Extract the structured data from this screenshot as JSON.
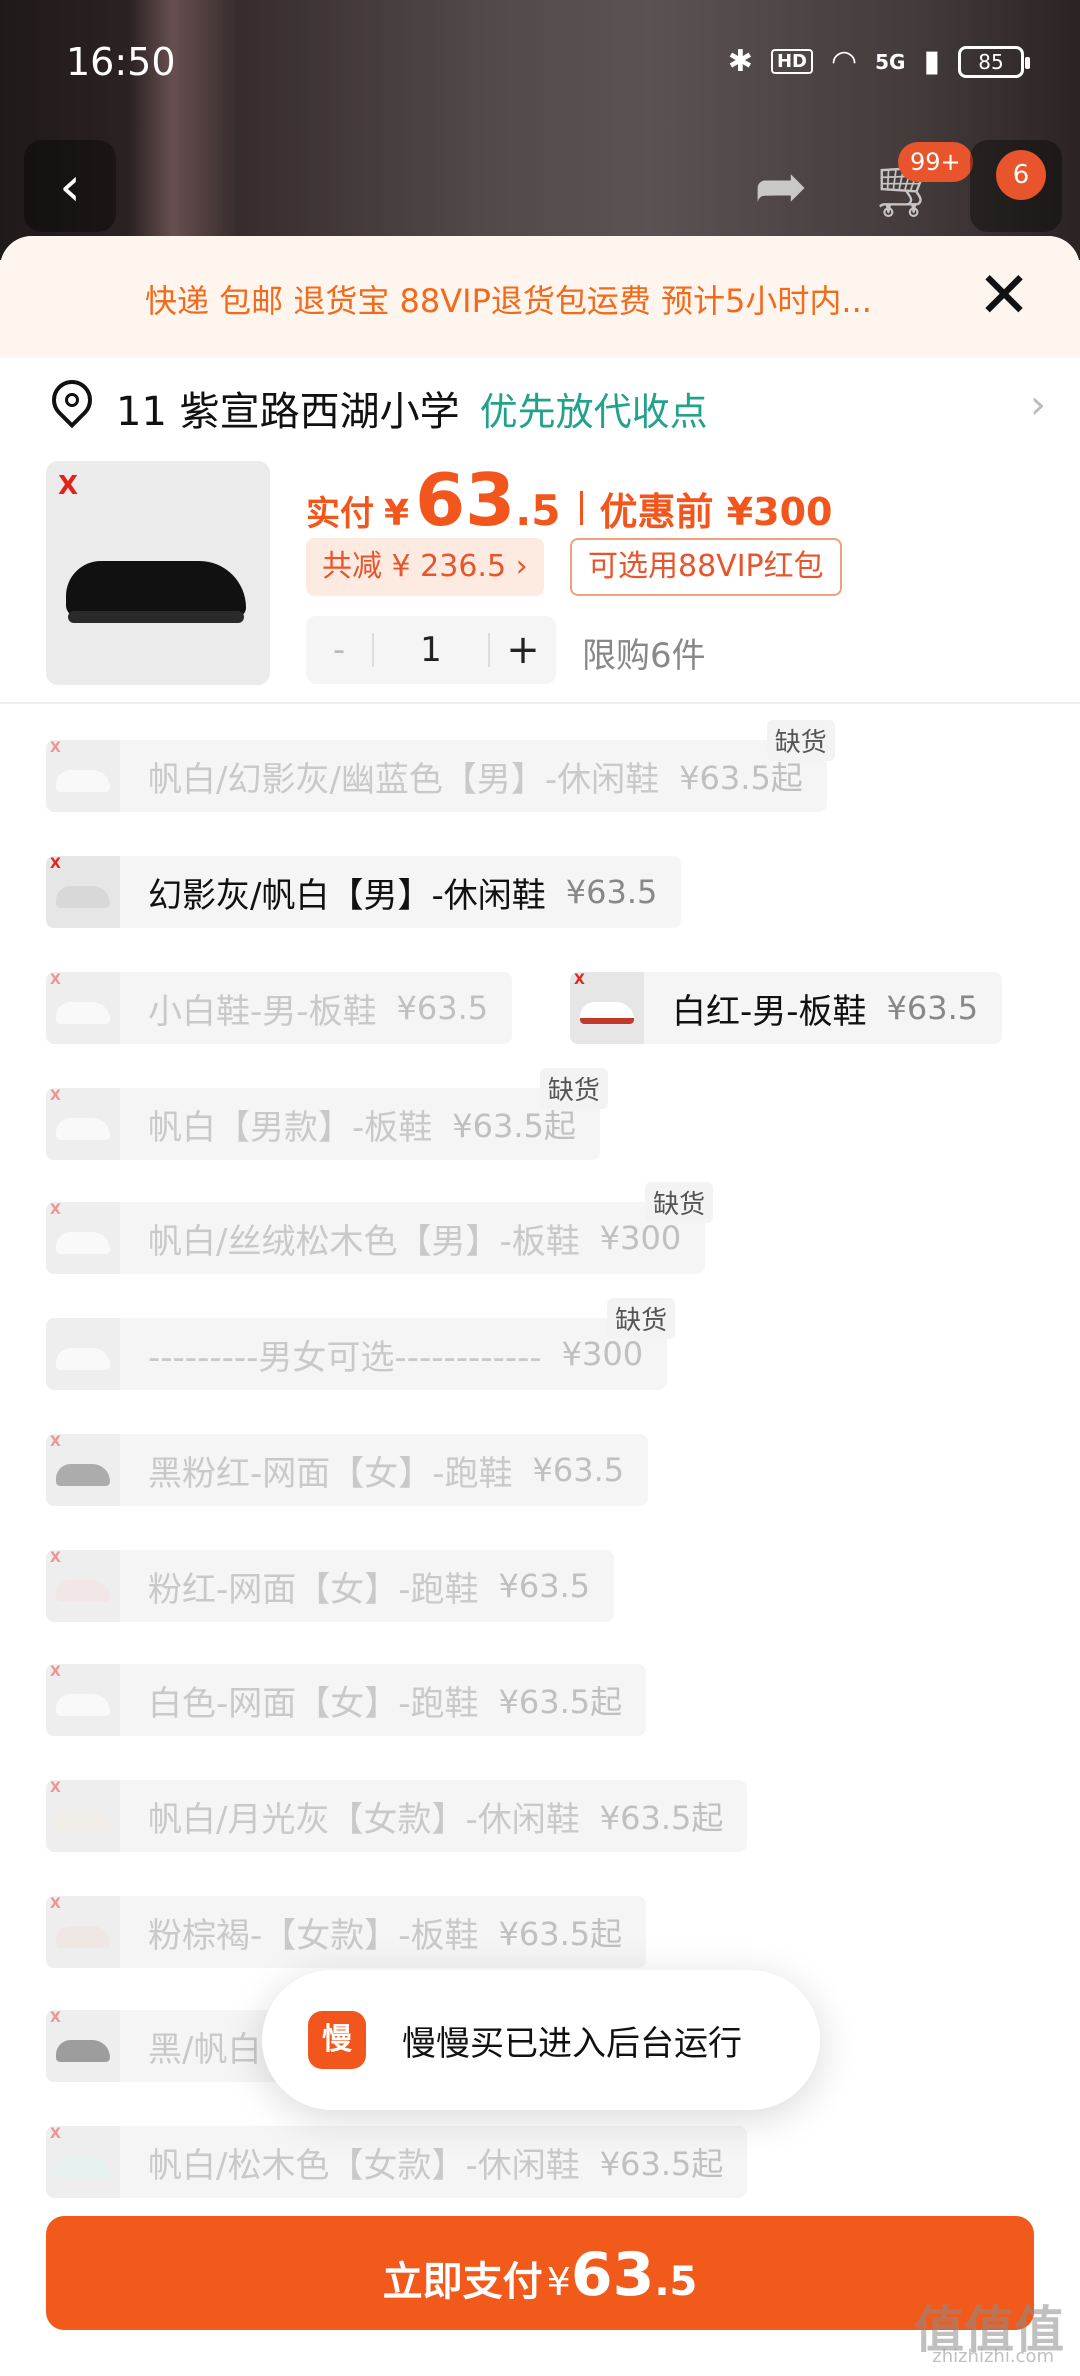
{
  "status_bar": {
    "time": "16:50",
    "hd": "HD",
    "network": "5G",
    "battery": "85"
  },
  "top_nav": {
    "cart_badge": "99+",
    "msg_badge": "6"
  },
  "promo_bar": {
    "text": "快递 包邮 退货宝 88VIP退货包运费 预计5小时内..."
  },
  "address": {
    "text": "11 紫宣路西湖小学",
    "pickup": "优先放代收点"
  },
  "product": {
    "brand_logo": "X",
    "pay_label": "实付",
    "currency": "¥",
    "price_int": "63",
    "price_dec": ".5",
    "original_price": "优惠前 ¥300",
    "discount": "共减 ¥ 236.5 ›",
    "vip": "可选用88VIP红包",
    "quantity": "1",
    "minus": "-",
    "plus": "+",
    "limit": "限购6件"
  },
  "sku_options": [
    {
      "label": "帆白/幻影灰/幽蓝色【男】-休闲鞋",
      "price": "¥63.5起",
      "oos": "缺货"
    },
    {
      "label": "幻影灰/帆白【男】-休闲鞋",
      "price": "¥63.5"
    },
    {
      "label": "小白鞋-男-板鞋",
      "price": "¥63.5"
    },
    {
      "label": "白红-男-板鞋",
      "price": "¥63.5"
    },
    {
      "label": "帆白【男款】-板鞋",
      "price": "¥63.5起",
      "oos": "缺货"
    },
    {
      "label": "帆白/丝绒松木色【男】-板鞋",
      "price": "¥300",
      "oos": "缺货"
    },
    {
      "label": "---------男女可选------------",
      "price": "¥300",
      "oos": "缺货"
    },
    {
      "label": "黑粉红-网面【女】-跑鞋",
      "price": "¥63.5"
    },
    {
      "label": "粉红-网面【女】-跑鞋",
      "price": "¥63.5"
    },
    {
      "label": "白色-网面【女】-跑鞋",
      "price": "¥63.5起"
    },
    {
      "label": "帆白/月光灰【女款】-休闲鞋",
      "price": "¥63.5起"
    },
    {
      "label": "粉棕褐-【女款】-板鞋",
      "price": "¥63.5起"
    },
    {
      "label": "黑/帆白",
      "price": ""
    },
    {
      "label": "帆白/松木色【女款】-休闲鞋",
      "price": "¥63.5起"
    }
  ],
  "toast": {
    "app_icon_text": "慢",
    "message": "慢慢买已进入后台运行"
  },
  "pay_button": {
    "label": "立即支付",
    "currency": "¥",
    "int": "63",
    "dec": ".5"
  },
  "watermark": {
    "text": "值值值",
    "sub": "zhizhizhi.com"
  }
}
